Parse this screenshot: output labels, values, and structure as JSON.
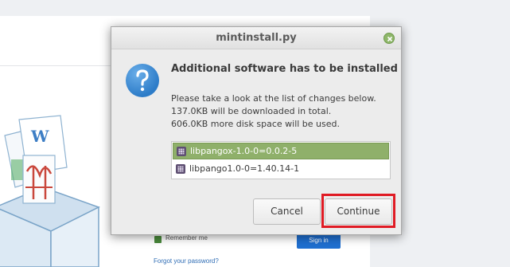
{
  "background": {
    "remember_label": "Remember me",
    "signin_label": "Sign in",
    "forgot_link": "Forgot your password?"
  },
  "dialog": {
    "title": "mintinstall.py",
    "heading": "Additional software has to be installed",
    "desc_lines": [
      "Please take a look at the list of changes below.",
      "137.0KB will be downloaded in total.",
      "606.0KB more disk space will be used."
    ],
    "packages": [
      {
        "name": "libpangox-1.0-0=0.0.2-5",
        "selected": true
      },
      {
        "name": "libpango1.0-0=1.40.14-1",
        "selected": false
      }
    ],
    "cancel_label": "Cancel",
    "continue_label": "Continue"
  },
  "colors": {
    "selection": "#8fb06a",
    "accent_highlight": "#e01b24",
    "info_blue": "#2d7cc8"
  },
  "icons": {
    "close": "close-icon",
    "info": "question-icon",
    "package": "package-icon"
  }
}
